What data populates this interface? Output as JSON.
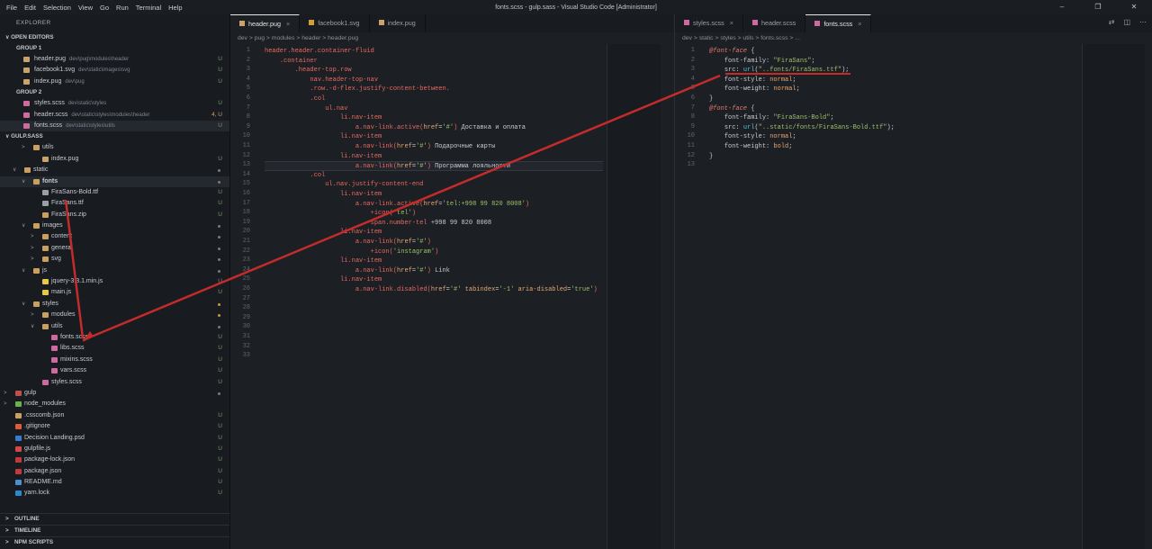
{
  "menu": [
    "File",
    "Edit",
    "Selection",
    "View",
    "Go",
    "Run",
    "Terminal",
    "Help"
  ],
  "window_title": "fonts.scss - gulp.sass - Visual Studio Code [Administrator]",
  "sidebar": {
    "title": "EXPLORER",
    "open_editors": "OPEN EDITORS",
    "group1": "GROUP 1",
    "group1_items": [
      {
        "name": "header.pug",
        "path": "dev\\pug\\modules\\header",
        "status": "U",
        "color": "#c9a36a"
      },
      {
        "name": "facebook1.svg",
        "path": "dev\\static\\images\\svg",
        "status": "U",
        "color": "#c9a36a"
      },
      {
        "name": "index.pug",
        "path": "dev\\pug",
        "status": "U",
        "color": "#c9a36a"
      }
    ],
    "group2": "GROUP 2",
    "group2_items": [
      {
        "name": "styles.scss",
        "path": "dev\\static\\styles",
        "status": "U",
        "color": "#cf6aa0"
      },
      {
        "name": "header.scss",
        "path": "dev\\static\\styles\\modules\\header",
        "status": "4, U",
        "color": "#cf6aa0"
      },
      {
        "name": "fonts.scss",
        "path": "dev\\static\\styles\\utils",
        "status": "U",
        "color": "#cf6aa0"
      }
    ],
    "workspace": "GULP.SASS",
    "tree": [
      {
        "name": "utils",
        "indent": 2,
        "type": "folder",
        "chev": ">",
        "status": ""
      },
      {
        "name": "index.pug",
        "indent": 3,
        "type": "pug",
        "status": "U"
      },
      {
        "name": "static",
        "indent": 1,
        "type": "folder",
        "chev": "v",
        "status": "dot"
      },
      {
        "name": "fonts",
        "indent": 2,
        "type": "folder",
        "chev": "v",
        "status": "dot",
        "bold": true
      },
      {
        "name": "FiraSans-Bold.ttf",
        "indent": 3,
        "type": "font",
        "status": "U"
      },
      {
        "name": "FiraSans.ttf",
        "indent": 3,
        "type": "font",
        "status": "U"
      },
      {
        "name": "FiraSans.zip",
        "indent": 3,
        "type": "zip",
        "status": "U"
      },
      {
        "name": "images",
        "indent": 2,
        "type": "folder",
        "chev": "v",
        "status": "dot"
      },
      {
        "name": "content",
        "indent": 3,
        "type": "folder",
        "chev": ">",
        "status": "dot"
      },
      {
        "name": "general",
        "indent": 3,
        "type": "folder",
        "chev": ">",
        "status": "dot"
      },
      {
        "name": "svg",
        "indent": 3,
        "type": "folder",
        "chev": ">",
        "status": "dot"
      },
      {
        "name": "js",
        "indent": 2,
        "type": "folder",
        "chev": "v",
        "status": "dot"
      },
      {
        "name": "jquery-3.3.1.min.js",
        "indent": 3,
        "type": "js",
        "status": "U"
      },
      {
        "name": "main.js",
        "indent": 3,
        "type": "js",
        "status": "U"
      },
      {
        "name": "styles",
        "indent": 2,
        "type": "folder",
        "chev": "v",
        "status": "dot-o"
      },
      {
        "name": "modules",
        "indent": 3,
        "type": "folder",
        "chev": ">",
        "status": "dot-o"
      },
      {
        "name": "utils",
        "indent": 3,
        "type": "folder",
        "chev": "v",
        "status": "dot"
      },
      {
        "name": "fonts.scss",
        "indent": 4,
        "type": "scss",
        "status": "U"
      },
      {
        "name": "libs.scss",
        "indent": 4,
        "type": "scss",
        "status": "U"
      },
      {
        "name": "mixins.scss",
        "indent": 4,
        "type": "scss",
        "status": "U"
      },
      {
        "name": "vars.scss",
        "indent": 4,
        "type": "scss",
        "status": "U"
      },
      {
        "name": "styles.scss",
        "indent": 3,
        "type": "scss",
        "status": "U"
      },
      {
        "name": "gulp",
        "indent": 0,
        "type": "folder-red",
        "chev": ">",
        "status": "dot"
      },
      {
        "name": "node_modules",
        "indent": 0,
        "type": "folder-g",
        "chev": ">",
        "status": ""
      },
      {
        "name": ".csscomb.json",
        "indent": 0,
        "type": "json",
        "status": "U"
      },
      {
        "name": ".gitignore",
        "indent": 0,
        "type": "git",
        "status": "U"
      },
      {
        "name": "Decision Landing.psd",
        "indent": 0,
        "type": "psd",
        "status": "U"
      },
      {
        "name": "gulpfile.js",
        "indent": 0,
        "type": "gulp",
        "status": "U"
      },
      {
        "name": "package-lock.json",
        "indent": 0,
        "type": "npm",
        "status": "U"
      },
      {
        "name": "package.json",
        "indent": 0,
        "type": "npm",
        "status": "U"
      },
      {
        "name": "README.md",
        "indent": 0,
        "type": "md",
        "status": "U"
      },
      {
        "name": "yarn.lock",
        "indent": 0,
        "type": "yarn",
        "status": "U"
      }
    ],
    "outline": "OUTLINE",
    "timeline": "TIMELINE",
    "npm": "NPM SCRIPTS"
  },
  "left_editor": {
    "tabs": [
      "header.pug",
      "facebook1.svg",
      "index.pug"
    ],
    "breadcrumb": "dev > pug > modules > header > header.pug",
    "lines": [
      [
        [
          "t",
          "header.header.container-fluid"
        ]
      ],
      [
        [
          "p",
          "    "
        ],
        [
          "t",
          ".container"
        ]
      ],
      [
        [
          "p",
          "        "
        ],
        [
          "t",
          ".header-top.row"
        ]
      ],
      [
        [
          "p",
          "            "
        ],
        [
          "t",
          "nav.header-top-nav"
        ]
      ],
      [
        [
          "p",
          "            "
        ],
        [
          "t",
          ".row.-d-flex.justify-content-between."
        ]
      ],
      [
        [
          "p",
          "            "
        ],
        [
          "t",
          ".col"
        ]
      ],
      [
        [
          "p",
          "                "
        ],
        [
          "t",
          "ul.nav"
        ]
      ],
      [
        [
          "p",
          "                    "
        ],
        [
          "t",
          "li.nav-item"
        ]
      ],
      [
        [
          "p",
          "                        "
        ],
        [
          "t",
          "a.nav-link.active("
        ],
        [
          "k",
          "href"
        ],
        [
          "p",
          "="
        ],
        [
          "s",
          "'#'"
        ],
        [
          "t",
          ")"
        ],
        [
          "p",
          " Доставка и оплата"
        ]
      ],
      [
        [
          "p",
          "                    "
        ],
        [
          "t",
          "li.nav-item"
        ]
      ],
      [
        [
          "p",
          "                        "
        ],
        [
          "t",
          "a.nav-link("
        ],
        [
          "k",
          "href"
        ],
        [
          "p",
          "="
        ],
        [
          "s",
          "'#'"
        ],
        [
          "t",
          ")"
        ],
        [
          "p",
          " Подарочные карты"
        ]
      ],
      [
        [
          "p",
          "                    "
        ],
        [
          "t",
          "li.nav-item"
        ]
      ],
      [
        [
          "p",
          "                        "
        ],
        [
          "t",
          "a.nav-link("
        ],
        [
          "k",
          "href"
        ],
        [
          "p",
          "="
        ],
        [
          "s",
          "'#'"
        ],
        [
          "t",
          ")"
        ],
        [
          "p",
          " Программа "
        ],
        [
          "p",
          "лояльности"
        ]
      ],
      [
        [
          "p",
          "            "
        ],
        [
          "t",
          ".col"
        ]
      ],
      [
        [
          "p",
          "                "
        ],
        [
          "t",
          "ul.nav.justify-content-end"
        ]
      ],
      [
        [
          "p",
          "                    "
        ],
        [
          "t",
          "li.nav-item"
        ]
      ],
      [
        [
          "p",
          "                        "
        ],
        [
          "t",
          "a.nav-link.active("
        ],
        [
          "k",
          "href"
        ],
        [
          "p",
          "="
        ],
        [
          "s",
          "'tel:+998 99 820 8008'"
        ],
        [
          "t",
          ")"
        ]
      ],
      [
        [
          "p",
          "                            "
        ],
        [
          "t",
          "+icon("
        ],
        [
          "s",
          "'tel'"
        ],
        [
          "t",
          ")"
        ]
      ],
      [
        [
          "p",
          "                            "
        ],
        [
          "t",
          "span.number-tel"
        ],
        [
          "p",
          " +998 99 820 8008"
        ]
      ],
      [
        [
          "p",
          "                    "
        ],
        [
          "t",
          "li.nav-item"
        ]
      ],
      [
        [
          "p",
          "                        "
        ],
        [
          "t",
          "a.nav-link("
        ],
        [
          "k",
          "href"
        ],
        [
          "p",
          "="
        ],
        [
          "s",
          "'#'"
        ],
        [
          "t",
          ")"
        ]
      ],
      [
        [
          "p",
          "                            "
        ],
        [
          "t",
          "+icon("
        ],
        [
          "s",
          "'instagram'"
        ],
        [
          "t",
          ")"
        ]
      ],
      [
        [
          "p",
          "                    "
        ],
        [
          "t",
          "li.nav-item"
        ]
      ],
      [
        [
          "p",
          "                        "
        ],
        [
          "t",
          "a.nav-link("
        ],
        [
          "k",
          "href"
        ],
        [
          "p",
          "="
        ],
        [
          "s",
          "'#'"
        ],
        [
          "t",
          ")"
        ],
        [
          "p",
          " Link"
        ]
      ],
      [
        [
          "p",
          "                    "
        ],
        [
          "t",
          "li.nav-item"
        ]
      ],
      [
        [
          "p",
          "                        "
        ],
        [
          "t",
          "a.nav-link.disabled("
        ],
        [
          "k",
          "href"
        ],
        [
          "p",
          "="
        ],
        [
          "s",
          "'#'"
        ],
        [
          "p",
          " "
        ],
        [
          "k",
          "tabindex"
        ],
        [
          "p",
          "="
        ],
        [
          "s",
          "'-1'"
        ],
        [
          "p",
          " "
        ],
        [
          "k",
          "aria-disabled"
        ],
        [
          "p",
          "="
        ],
        [
          "s",
          "'true'"
        ],
        [
          "t",
          ")"
        ]
      ],
      [],
      [],
      [],
      [],
      [],
      [],
      []
    ]
  },
  "right_editor": {
    "tabs": [
      "styles.scss",
      "header.scss",
      "fonts.scss"
    ],
    "breadcrumb": "dev > static > styles > utils > fonts.scss > ...",
    "lines": [
      [
        [
          "it",
          "@font-face"
        ],
        [
          "p",
          " {"
        ]
      ],
      [
        [
          "p",
          "    "
        ],
        [
          "p",
          "font-family: "
        ],
        [
          "s",
          "\"FiraSans\""
        ],
        [
          "p",
          ";"
        ]
      ],
      [
        [
          "p",
          "    "
        ],
        [
          "p",
          "src: "
        ],
        [
          "cy",
          "url"
        ],
        [
          "p",
          "("
        ],
        [
          "s",
          "\"..fonts/FiraSans.ttf\""
        ],
        [
          "p",
          ");"
        ]
      ],
      [
        [
          "p",
          "    "
        ],
        [
          "p",
          "font-style: "
        ],
        [
          "k",
          "normal"
        ],
        [
          "p",
          ";"
        ]
      ],
      [
        [
          "p",
          "    "
        ],
        [
          "p",
          "font-weight: "
        ],
        [
          "k",
          "normal"
        ],
        [
          "p",
          ";"
        ]
      ],
      [
        [
          "p",
          "}"
        ]
      ],
      [
        [
          "it",
          "@font-face"
        ],
        [
          "p",
          " {"
        ]
      ],
      [
        [
          "p",
          "    "
        ],
        [
          "p",
          "font-family: "
        ],
        [
          "s",
          "\"FiraSans-Bold\""
        ],
        [
          "p",
          ";"
        ]
      ],
      [
        [
          "p",
          "    "
        ],
        [
          "p",
          "src: "
        ],
        [
          "cy",
          "url"
        ],
        [
          "p",
          "("
        ],
        [
          "s",
          "\"..static/fonts/FiraSans-Bold.ttf\""
        ],
        [
          "p",
          ");"
        ]
      ],
      [
        [
          "p",
          "    "
        ],
        [
          "p",
          "font-style: "
        ],
        [
          "k",
          "normal"
        ],
        [
          "p",
          ";"
        ]
      ],
      [
        [
          "p",
          "    "
        ],
        [
          "p",
          "font-weight: "
        ],
        [
          "k",
          "bold"
        ],
        [
          "p",
          ";"
        ]
      ],
      [
        [
          "p",
          "}"
        ]
      ],
      []
    ]
  }
}
